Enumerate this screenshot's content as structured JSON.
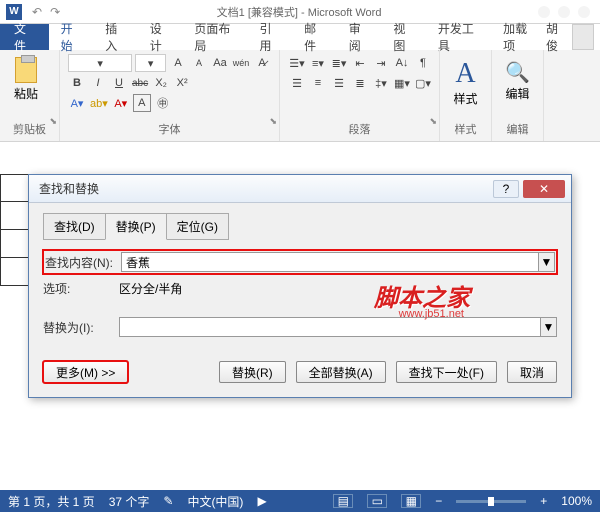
{
  "titlebar": {
    "doc": "文档1 [兼容模式] - Microsoft Word"
  },
  "tabs": {
    "file": "文件",
    "home": "开始",
    "insert": "插入",
    "design": "设计",
    "layout": "页面布局",
    "ref": "引用",
    "mail": "邮件",
    "review": "审阅",
    "view": "视图",
    "dev": "开发工具",
    "addin": "加载项",
    "user": "胡俊"
  },
  "ribbon": {
    "clipboard": {
      "title": "剪贴板",
      "paste": "粘贴"
    },
    "font": {
      "title": "字体",
      "b": "B",
      "i": "I",
      "u": "U",
      "abc": "abc",
      "x2": "X₂",
      "x2u": "X²",
      "wen": "wén",
      "a1": "A",
      "a2": "A",
      "aa": "Aa"
    },
    "para": {
      "title": "段落"
    },
    "style": {
      "title": "样式",
      "label": "样式"
    },
    "edit": {
      "title": "编辑",
      "label": "编辑"
    }
  },
  "dialog": {
    "title": "查找和替换",
    "tabs": {
      "find": "查找(D)",
      "replace": "替换(P)",
      "goto": "定位(G)"
    },
    "findLabel": "查找内容(N):",
    "findValue": "香蕉",
    "optLabel": "选项:",
    "optValue": "区分全/半角",
    "replaceLabel": "替换为(I):",
    "replaceValue": "",
    "more": "更多(M) >>",
    "btnReplace": "替换(R)",
    "btnReplaceAll": "全部替换(A)",
    "btnFindNext": "查找下一处(F)",
    "btnCancel": "取消"
  },
  "watermark": {
    "main": "脚本之家",
    "sub": "www.jb51.net"
  },
  "status": {
    "page": "第 1 页，共 1 页",
    "words": "37 个字",
    "lang": "中文(中国)",
    "zoom": "100%",
    "minus": "−",
    "plus": "+"
  }
}
